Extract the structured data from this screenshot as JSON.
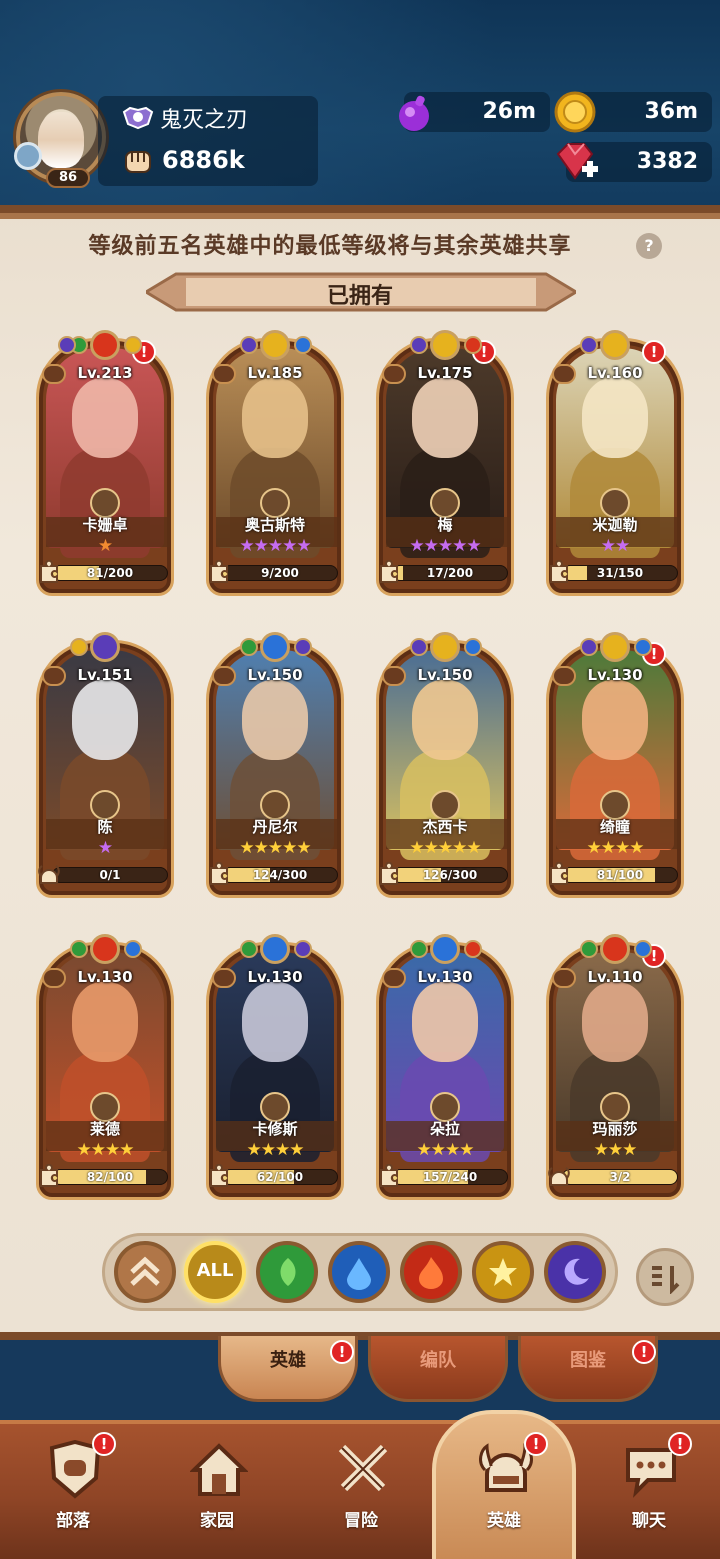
{
  "player": {
    "level": "86",
    "guild_name": "鬼灭之刃",
    "power": "6886k"
  },
  "resources": {
    "potion": "26m",
    "gold": "36m",
    "gems": "3382"
  },
  "notice": "等级前五名英雄中的最低等级将与其余英雄共享",
  "help_label": "?",
  "section_title": "已拥有",
  "colors": {
    "fire": "#d8351c",
    "nature": "#2f9a3a",
    "water": "#2a72d8",
    "light": "#e6b21e",
    "dark": "#5a3db8",
    "badge": "#e02424",
    "star_gold": "#ffcf3a",
    "star_purple": "#c56cf0",
    "star_orange": "#f08a30"
  },
  "heroes": [
    {
      "level": "Lv.213",
      "name": "卡姗卓",
      "stars": "★",
      "star_color": "orange",
      "progress": "81/200",
      "fill": 0.405,
      "badge": "!",
      "art": [
        "#c95656",
        "#f0b7a8",
        "#8f3b2f"
      ]
    },
    {
      "level": "Lv.185",
      "name": "奥古斯特",
      "stars": "★★★★★",
      "star_color": "purple",
      "progress": "9/200",
      "fill": 0.045,
      "badge": "",
      "art": [
        "#b98e57",
        "#e6c08a",
        "#6d4b2a"
      ]
    },
    {
      "level": "Lv.175",
      "name": "梅",
      "stars": "★★★★★",
      "star_color": "purple",
      "progress": "17/200",
      "fill": 0.085,
      "badge": "!",
      "art": [
        "#4d3a2a",
        "#f0d2b8",
        "#2a1e18"
      ]
    },
    {
      "level": "Lv.160",
      "name": "米迦勒",
      "stars": "★★",
      "star_color": "purple",
      "progress": "31/150",
      "fill": 0.207,
      "badge": "!",
      "art": [
        "#dcd4b6",
        "#f4e6c4",
        "#b08a3a"
      ]
    },
    {
      "level": "Lv.151",
      "name": "陈",
      "stars": "★",
      "star_color": "purple",
      "progress": "0/1",
      "fill": 0.0,
      "badge": "",
      "art": [
        "#3a3a44",
        "#e8e8ea",
        "#7a4a2a"
      ]
    },
    {
      "level": "Lv.150",
      "name": "丹尼尔",
      "stars": "★★★★★",
      "star_color": "gold",
      "progress": "124/300",
      "fill": 0.413,
      "badge": "",
      "art": [
        "#4f7fb0",
        "#e8c8a8",
        "#6d5038"
      ]
    },
    {
      "level": "Lv.150",
      "name": "杰西卡",
      "stars": "★★★★★",
      "star_color": "gold",
      "progress": "126/300",
      "fill": 0.42,
      "badge": "",
      "art": [
        "#4a6d94",
        "#f0c890",
        "#d8c060"
      ]
    },
    {
      "level": "Lv.130",
      "name": "绮瞳",
      "stars": "★★★★",
      "star_color": "gold",
      "progress": "81/100",
      "fill": 0.81,
      "badge": "!",
      "art": [
        "#4d7a3a",
        "#f0b080",
        "#d86a3a"
      ]
    },
    {
      "level": "Lv.130",
      "name": "莱德",
      "stars": "★★★★",
      "star_color": "gold",
      "progress": "82/100",
      "fill": 0.82,
      "badge": "",
      "art": [
        "#7a4a30",
        "#e89a6a",
        "#c0502a"
      ]
    },
    {
      "level": "Lv.130",
      "name": "卡修斯",
      "stars": "★★★★",
      "star_color": "gold",
      "progress": "62/100",
      "fill": 0.62,
      "badge": "",
      "art": [
        "#2a3a5a",
        "#c8c8d8",
        "#1a2030"
      ]
    },
    {
      "level": "Lv.130",
      "name": "朵拉",
      "stars": "★★★★",
      "star_color": "gold",
      "progress": "157/240",
      "fill": 0.654,
      "badge": "",
      "art": [
        "#3a6aa8",
        "#f0c8a8",
        "#6a4ab0"
      ]
    },
    {
      "level": "Lv.110",
      "name": "玛丽莎",
      "stars": "★★★",
      "star_color": "gold",
      "progress": "3/2",
      "fill": 1.0,
      "badge": "!",
      "art": [
        "#8a6a4a",
        "#e0a888",
        "#4a3a2a"
      ]
    }
  ],
  "filters": [
    {
      "name": "collapse",
      "label": ""
    },
    {
      "name": "all",
      "label": "ALL"
    },
    {
      "name": "nature",
      "label": ""
    },
    {
      "name": "water",
      "label": ""
    },
    {
      "name": "fire",
      "label": ""
    },
    {
      "name": "light",
      "label": ""
    },
    {
      "name": "dark",
      "label": ""
    }
  ],
  "subtabs": [
    {
      "label": "英雄",
      "badge": "!"
    },
    {
      "label": "编队",
      "badge": ""
    },
    {
      "label": "图鉴",
      "badge": "!"
    }
  ],
  "nav": [
    {
      "label": "部落",
      "badge": "!"
    },
    {
      "label": "家园",
      "badge": ""
    },
    {
      "label": "冒险",
      "badge": ""
    },
    {
      "label": "英雄",
      "badge": "!"
    },
    {
      "label": "聊天",
      "badge": "!"
    }
  ]
}
